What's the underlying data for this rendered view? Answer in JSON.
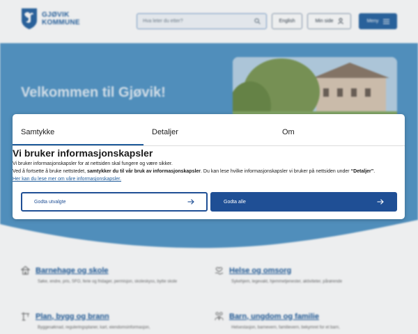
{
  "header": {
    "logo_line1": "GJØVIK",
    "logo_line2": "KOMMUNE",
    "search_placeholder": "Hva leter du etter?",
    "english_label": "English",
    "minside_label": "Min side",
    "meny_label": "Meny"
  },
  "hero": {
    "title": "Velkommen til Gjøvik!"
  },
  "cards": [
    {
      "title": "Barnehage og skole",
      "desc": "Søke, endre, pris, SFO, ferie og fridager, permisjon, skoleskyss, bytte skole",
      "icon": "school-icon"
    },
    {
      "title": "Helse og omsorg",
      "desc": "Sykehjem, legevakt, hjemmetjenester, aktiviteter, pårørende",
      "icon": "heart-hand-icon"
    },
    {
      "title": "Plan, bygg og brann",
      "desc": "Byggesøknad, reguleringsplaner, kart, eiendomsinformasjon,",
      "icon": "crane-icon"
    },
    {
      "title": "Barn, ungdom og familie",
      "desc": "Helsestasjon, barnevern, familievern, bekymret for et barn,",
      "icon": "family-icon"
    }
  ],
  "consent": {
    "tabs": [
      "Samtykke",
      "Detaljer",
      "Om"
    ],
    "active_tab": "Samtykke",
    "title": "Vi bruker informasjonskapsler",
    "line1": "Vi bruker informasjonskapsler for at nettsiden skal fungere og være sikker.",
    "line2_a": "Ved å fortsette å bruke nettstedet, ",
    "line2_b": "samtykker du til vår bruk av informasjonskapsler",
    "line2_c": ".  Du kan lese hvilke informasjonskapsler vi bruker på nettsiden under ",
    "line2_d": "“Detaljer”",
    "line2_e": ".",
    "link": "Her kan du lese mer om våre informasjonskapsler.",
    "btn_selected": "Godta utvalgte",
    "btn_all": "Godta alle"
  },
  "colors": {
    "brand": "#2b66a3",
    "hero": "#5597c7",
    "button": "#1f4f95"
  }
}
